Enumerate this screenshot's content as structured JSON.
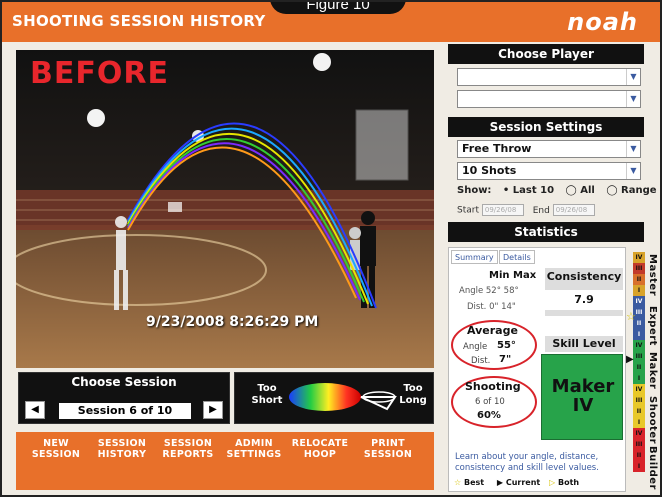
{
  "header": {
    "title": "SHOOTING SESSION HISTORY",
    "figure_label": "Figure 10",
    "logo": "noah"
  },
  "video": {
    "before_label": "BEFORE",
    "timestamp": "9/23/2008 8:26:29 PM"
  },
  "choose_session": {
    "title": "Choose Session",
    "value": "Session 6 of 10",
    "prev_icon": "◀",
    "next_icon": "▶"
  },
  "range_legend": {
    "too_short": "Too\nShort",
    "too_long": "Too\nLong"
  },
  "menu": [
    {
      "label": "NEW\nSESSION"
    },
    {
      "label": "SESSION\nHISTORY"
    },
    {
      "label": "SESSION\nREPORTS"
    },
    {
      "label": "ADMIN\nSETTINGS"
    },
    {
      "label": "RELOCATE\nHOOP"
    },
    {
      "label": "PRINT\nSESSION"
    }
  ],
  "choose_player": {
    "title": "Choose Player",
    "dropdown1": "",
    "dropdown2": ""
  },
  "session_settings": {
    "title": "Session Settings",
    "shot_type": "Free Throw",
    "shot_count": "10 Shots",
    "show_label": "Show:",
    "show_last10": "Last 10",
    "show_all": "All",
    "show_range": "Range",
    "start_label": "Start",
    "start_date": "09/26/08",
    "end_label": "End",
    "end_date": "09/26/08"
  },
  "statistics": {
    "title": "Statistics",
    "tab_summary": "Summary",
    "tab_details": "Details",
    "min_label": "Min",
    "max_label": "Max",
    "angle_row": "Angle 52° 58°",
    "dist_row": "Dist. 0\" 14\"",
    "consistency_label": "Consistency",
    "consistency_value": "7.9",
    "skill_label": "Skill Level",
    "skill_value": "Maker\nIV",
    "average_label": "Average",
    "avg_angle_label": "Angle",
    "avg_angle_value": "55°",
    "avg_dist_label": "Dist.",
    "avg_dist_value": "7\"",
    "shooting_label": "Shooting",
    "shooting_count": "6 of 10",
    "shooting_pct": "60%",
    "learn_text": "Learn about your angle, distance, consistency and skill level values.",
    "legend_best": "Best",
    "legend_current": "Current",
    "legend_both": "Both"
  },
  "scale": {
    "levels": [
      "Master",
      "Expert",
      "Maker",
      "Shooter",
      "Builder"
    ],
    "rungs": [
      "IV",
      "III",
      "II",
      "I",
      "IV",
      "III",
      "II",
      "I",
      "IV",
      "III",
      "II",
      "I",
      "IV",
      "III",
      "II",
      "I",
      "IV",
      "III",
      "II",
      "I"
    ]
  },
  "colors": {
    "orange": "#e8702a",
    "red": "#d8232a",
    "green": "#27a34a"
  }
}
